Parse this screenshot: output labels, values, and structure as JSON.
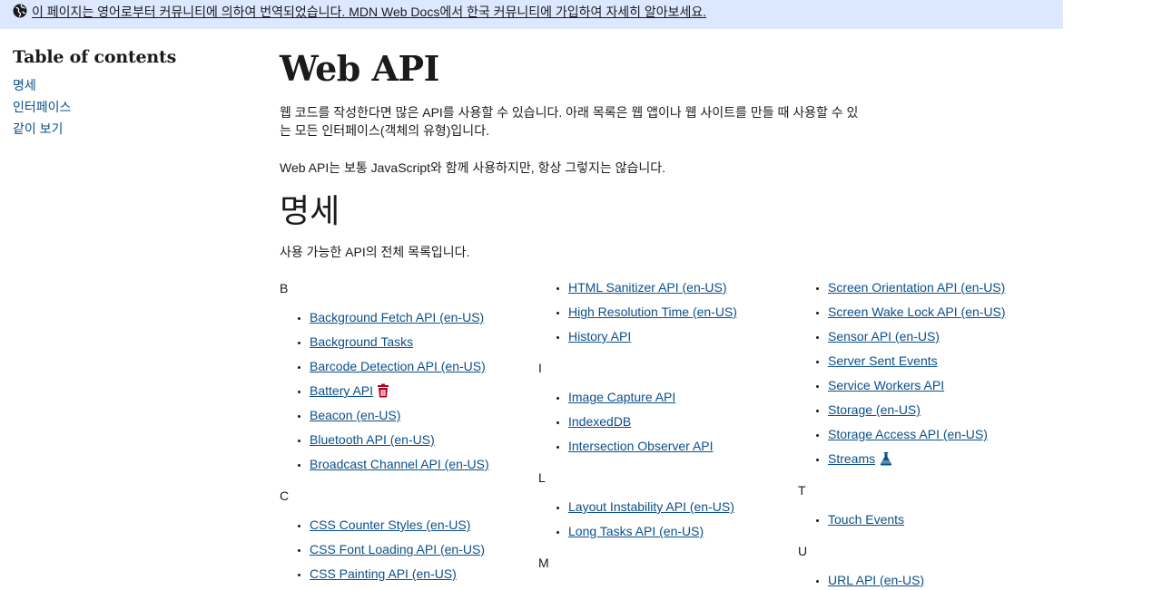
{
  "banner": {
    "text": "이 페이지는 영어로부터 커뮤니티에 의하여 번역되었습니다. MDN Web Docs에서 한국 커뮤니티에 가입하여 자세히 알아보세요.",
    "icon": "globe-icon"
  },
  "toc": {
    "title": "Table of contents",
    "items": [
      "명세",
      "인터페이스",
      "같이 보기"
    ]
  },
  "page": {
    "title": "Web API",
    "intro": "웹 코드를 작성한다면 많은 API를 사용할 수 있습니다. 아래 목록은 웹 앱이나 웹 사이트를 만들 때 사용할 수 있는 모든 인터페이스(객체의 유형)입니다.",
    "intro2": "Web API는 보통 JavaScript와 함께 사용하지만, 항상 그렇지는 않습니다.",
    "section_title": "명세",
    "section_desc": "사용 가능한 API의 전체 목록입니다."
  },
  "columns": {
    "col1": {
      "groups": [
        {
          "letter": "B",
          "items": [
            {
              "label": "Background Fetch API (en-US)"
            },
            {
              "label": "Background Tasks"
            },
            {
              "label": "Barcode Detection API (en-US)"
            },
            {
              "label": "Battery API",
              "icon": "trash-icon"
            },
            {
              "label": "Beacon (en-US)"
            },
            {
              "label": "Bluetooth API (en-US)"
            },
            {
              "label": "Broadcast Channel API (en-US)"
            }
          ]
        },
        {
          "letter": "C",
          "items": [
            {
              "label": "CSS Counter Styles (en-US)"
            },
            {
              "label": "CSS Font Loading API (en-US)"
            },
            {
              "label": "CSS Painting API (en-US)"
            }
          ]
        }
      ]
    },
    "col2": {
      "lead_items": [
        {
          "label": "HTML Sanitizer API (en-US)"
        },
        {
          "label": "High Resolution Time (en-US)"
        },
        {
          "label": "History API"
        }
      ],
      "groups": [
        {
          "letter": "I",
          "items": [
            {
              "label": "Image Capture API"
            },
            {
              "label": "IndexedDB"
            },
            {
              "label": "Intersection Observer API"
            }
          ]
        },
        {
          "letter": "L",
          "items": [
            {
              "label": "Layout Instability API (en-US)"
            },
            {
              "label": "Long Tasks API (en-US)"
            }
          ]
        },
        {
          "letter": "M",
          "items": []
        }
      ]
    },
    "col3": {
      "lead_items": [
        {
          "label": "Screen Orientation API (en-US)"
        },
        {
          "label": "Screen Wake Lock API (en-US)"
        },
        {
          "label": "Sensor API (en-US)"
        },
        {
          "label": "Server Sent Events"
        },
        {
          "label": "Service Workers API"
        },
        {
          "label": "Storage (en-US)"
        },
        {
          "label": "Storage Access API (en-US)"
        },
        {
          "label": "Streams",
          "icon": "flask-icon"
        }
      ],
      "groups": [
        {
          "letter": "T",
          "items": [
            {
              "label": "Touch Events"
            }
          ]
        },
        {
          "letter": "U",
          "items": [
            {
              "label": "URL API (en-US)"
            }
          ]
        }
      ]
    }
  },
  "colors": {
    "banner_bg": "#dce8ff",
    "link": "#0b4f8a",
    "deprecated_icon": "#b00020",
    "experimental_icon": "#0b4f8a"
  }
}
